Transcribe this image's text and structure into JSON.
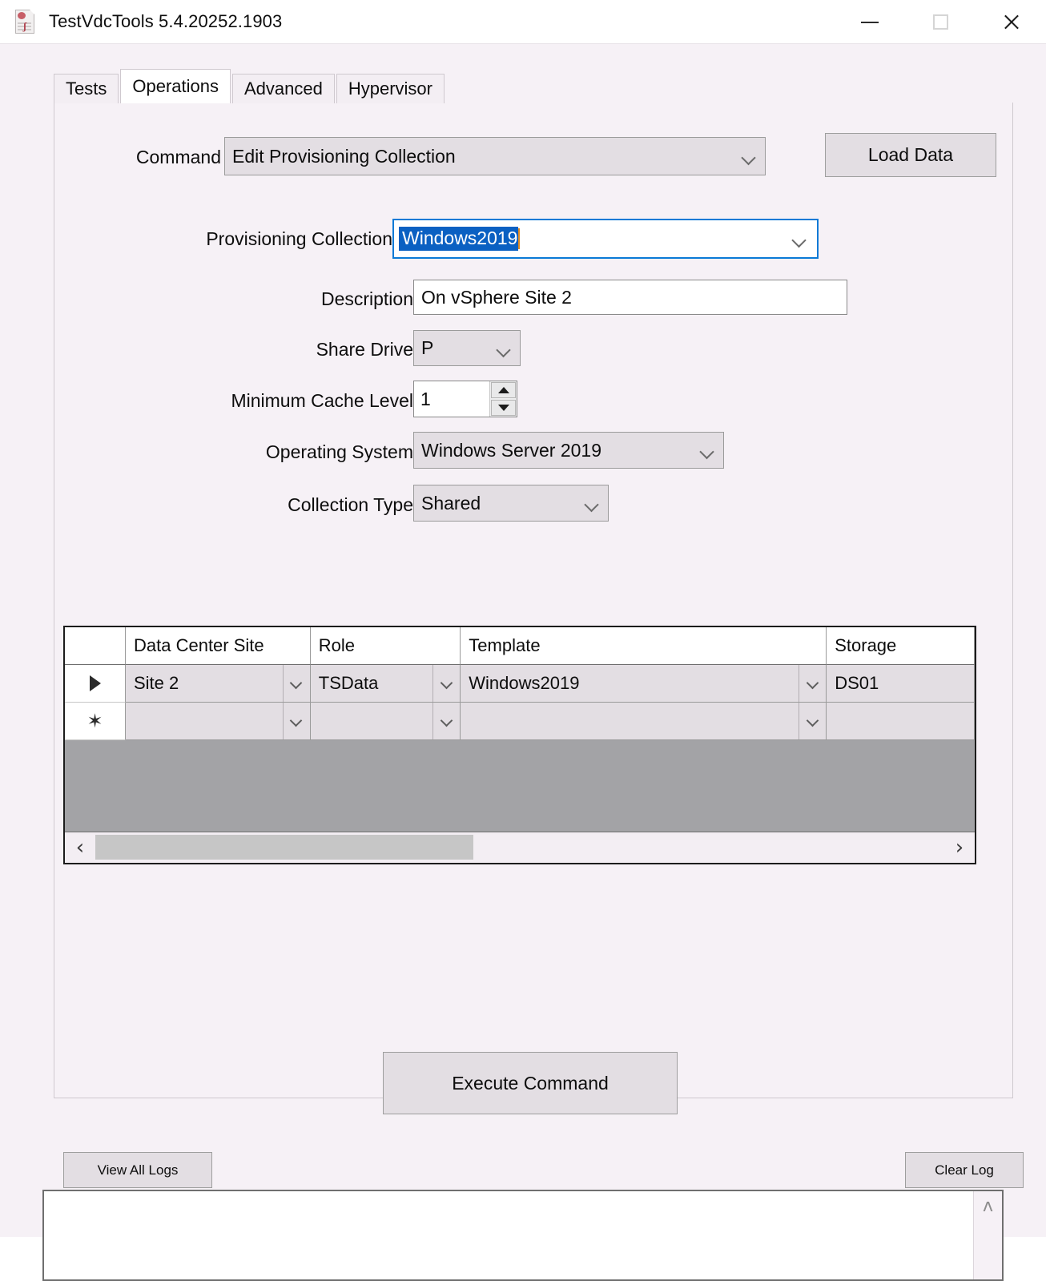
{
  "window": {
    "title": "TestVdcTools 5.4.20252.1903",
    "icon": "document-icon",
    "controls": {
      "minimize": "minimize-icon",
      "maximize": "maximize-icon",
      "close": "close-icon"
    }
  },
  "tabs": [
    {
      "label": "Tests",
      "active": false
    },
    {
      "label": "Operations",
      "active": true
    },
    {
      "label": "Advanced",
      "active": false
    },
    {
      "label": "Hypervisor",
      "active": false
    }
  ],
  "form": {
    "command": {
      "label": "Command",
      "value": "Edit Provisioning Collection"
    },
    "load_data_label": "Load Data",
    "provisioning_collection": {
      "label": "Provisioning Collection",
      "value": "Windows2019",
      "selected": true
    },
    "description": {
      "label": "Description",
      "value": "On vSphere Site 2"
    },
    "share_drive": {
      "label": "Share Drive",
      "value": "P"
    },
    "minimum_cache_level": {
      "label": "Minimum Cache Level",
      "value": "1"
    },
    "operating_system": {
      "label": "Operating System",
      "value": "Windows Server 2019"
    },
    "collection_type": {
      "label": "Collection Type",
      "value": "Shared"
    }
  },
  "grid": {
    "columns": [
      "Data Center Site",
      "Role",
      "Template",
      "Storage"
    ],
    "rows": [
      {
        "marker": "current-row",
        "cells": [
          "Site 2",
          "TSData",
          "Windows2019",
          "DS01"
        ]
      },
      {
        "marker": "new-row",
        "cells": [
          "",
          "",
          "",
          ""
        ]
      }
    ],
    "scroll_left_icon": "‹",
    "scroll_right_icon": "›"
  },
  "actions": {
    "execute_command": "Execute Command",
    "view_all_logs": "View All Logs",
    "clear_log": "Clear Log"
  },
  "log": {
    "value": "",
    "scroll_up_icon": "ʌ"
  },
  "colors": {
    "client_background": "#f6f1f6",
    "control_face": "#e3dee3",
    "grid_background": "#a3a3a6",
    "selection_blue": "#0a60c2",
    "focus_border": "#0a7ad6",
    "caret_orange": "#e08a20"
  }
}
